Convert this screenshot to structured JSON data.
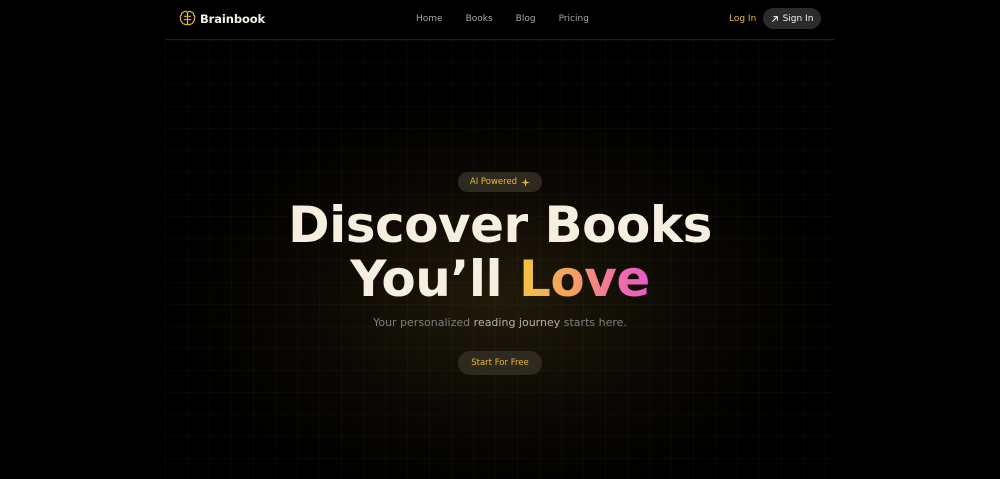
{
  "nav": {
    "brand": "Brainbook",
    "links": [
      "Home",
      "Books",
      "Blog",
      "Pricing"
    ],
    "login_label": "Log In",
    "signin_label": "Sign In"
  },
  "hero": {
    "badge_label": "AI Powered",
    "headline_line1": "Discover Books",
    "headline_line2_prefix": "You’ll ",
    "headline_line2_highlight": "Love",
    "subtitle_before": "Your personalized ",
    "subtitle_highlight": "reading journey",
    "subtitle_after": " starts here.",
    "cta_label": "Start For Free"
  },
  "colors": {
    "accent": "#e7b93a",
    "background": "#000000",
    "headline": "#f6eede",
    "gradient_start": "#f2c544",
    "gradient_end": "#e959c8"
  },
  "icons": {
    "brand": "brain-icon",
    "signin": "arrow-up-right-icon",
    "badge": "sparkle-icon"
  }
}
